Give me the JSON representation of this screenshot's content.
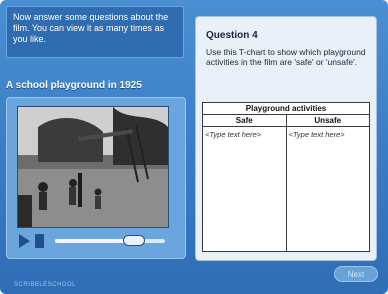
{
  "instructions": "Now answer some questions about the film. You can view it as many times as you like.",
  "video": {
    "title": "A school playground in 1925",
    "progress": 0.72
  },
  "question": {
    "heading": "Question 4",
    "text": "Use this T-chart to show which playground activities in the film are 'safe' or 'unsafe'."
  },
  "tchart": {
    "title": "Playground activities",
    "columns": [
      "Safe",
      "Unsafe"
    ],
    "placeholders": [
      "<Type text here>",
      "<Type text here>"
    ]
  },
  "buttons": {
    "next": "Next"
  },
  "footer": {
    "logo": "SCRIBBLESCHOOL"
  },
  "icons": {
    "play": "play-icon",
    "stop": "stop-icon"
  }
}
